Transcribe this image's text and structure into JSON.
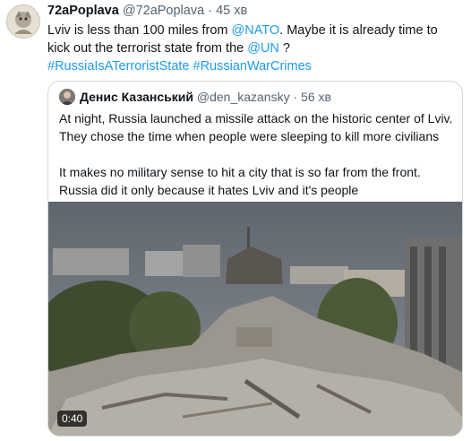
{
  "tweet": {
    "name": "72aPoplava",
    "handle": "@72aPoplava",
    "separator": "·",
    "time": "45 хв",
    "text_part1": "Lviv is less than 100 miles from ",
    "mention_nato": "@NATO",
    "text_part2": ". Maybe it is already time to kick out the terrorist state from the ",
    "mention_un": "@UN",
    "text_part3": " ?",
    "hashtag1": "#RussiaIsATerroristState",
    "hashtag2": "#RussianWarCrimes"
  },
  "quoted": {
    "name": "Денис Казанський",
    "handle": "@den_kazansky",
    "separator": "·",
    "time": "56 хв",
    "paragraph1": "At night, Russia launched a missile attack on the historic center of Lviv. They chose the time when people were sleeping to kill more civilians",
    "paragraph2": "It makes no military sense to hit a city that is so far from the front. Russia did it only because it hates Lviv and it's people",
    "video_duration": "0:40"
  },
  "colors": {
    "link": "#1d9bf0",
    "secondary_text": "#536471",
    "border": "#cfd9de"
  }
}
